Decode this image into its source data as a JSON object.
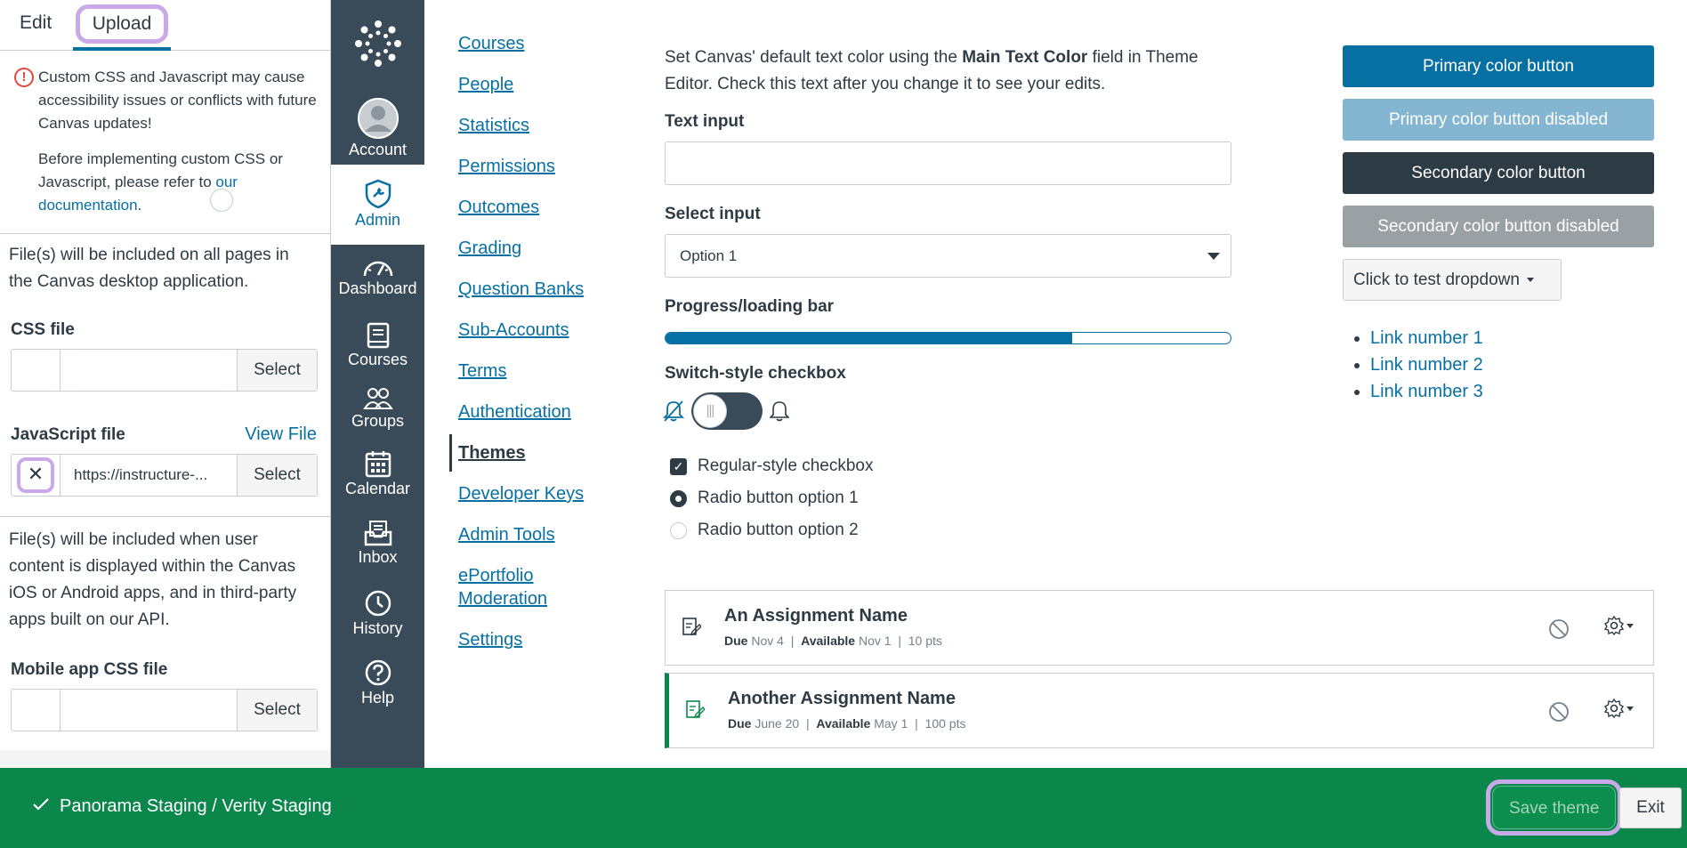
{
  "left_panel": {
    "tabs": [
      "Edit",
      "Upload"
    ],
    "warning_line1": "Custom CSS and Javascript may cause accessibility issues or conflicts with future Canvas updates!",
    "warning_line2_prefix": "Before implementing custom CSS or Javascript, please refer to ",
    "warning_link": "our documentation",
    "warning_line2_suffix": ".",
    "desktop_desc": "File(s) will be included on all pages in the Canvas desktop application.",
    "css_label": "CSS file",
    "css_value": "",
    "select_label": "Select",
    "js_label": "JavaScript file",
    "view_file": "View File",
    "js_value": "https://instructure-...",
    "mobile_desc": "File(s) will be included when user content is displayed within the Canvas iOS or Android apps, and in third-party apps built on our API.",
    "mobile_css_label": "Mobile app CSS file",
    "mobile_css_value": ""
  },
  "global_nav": {
    "items": [
      "Account",
      "Admin",
      "Dashboard",
      "Courses",
      "Groups",
      "Calendar",
      "Inbox",
      "History",
      "Help"
    ],
    "active": "Admin"
  },
  "sub_nav": {
    "items": [
      "Courses",
      "People",
      "Statistics",
      "Permissions",
      "Outcomes",
      "Grading",
      "Question Banks",
      "Sub-Accounts",
      "Terms",
      "Authentication",
      "Themes",
      "Developer Keys",
      "Admin Tools",
      "ePortfolio",
      "Moderation",
      "Settings"
    ],
    "active": "Themes"
  },
  "preview": {
    "intro_prefix": "Set Canvas' default text color using the ",
    "intro_bold": "Main Text Color",
    "intro_suffix": " field in Theme Editor. Check this text after you change it to see your edits.",
    "text_input_label": "Text input",
    "select_input_label": "Select input",
    "select_value": "Option 1",
    "progress_label": "Progress/loading bar",
    "progress_value": 0.72,
    "switch_label": "Switch-style checkbox",
    "switch_knob": "|||",
    "checkbox_label": "Regular-style checkbox",
    "radio1_label": "Radio button option 1",
    "radio2_label": "Radio button option 2",
    "assignments": [
      {
        "name": "An Assignment Name",
        "due_label": "Due",
        "due": "Nov 4",
        "avail_label": "Available",
        "available": "Nov 1",
        "sep": "|",
        "points": "10 pts"
      },
      {
        "name": "Another Assignment Name",
        "due_label": "Due",
        "due": "June 20",
        "avail_label": "Available",
        "available": "May 1",
        "sep": "|",
        "points": "100 pts"
      }
    ],
    "buttons": {
      "primary": "Primary color button",
      "primary_disabled": "Primary color button disabled",
      "secondary": "Secondary color button",
      "secondary_disabled": "Secondary color button disabled",
      "dropdown": "Click to test dropdown"
    },
    "links": [
      "Link number 1",
      "Link number 2",
      "Link number 3"
    ]
  },
  "footer": {
    "account_path": "Panorama Staging / Verity Staging",
    "save": "Save theme",
    "exit": "Exit"
  },
  "colors": {
    "primary": "#0770a3",
    "nav_bg": "#394b58",
    "footer_bg": "#0b874b",
    "highlight_outline": "#c9a9e8"
  }
}
